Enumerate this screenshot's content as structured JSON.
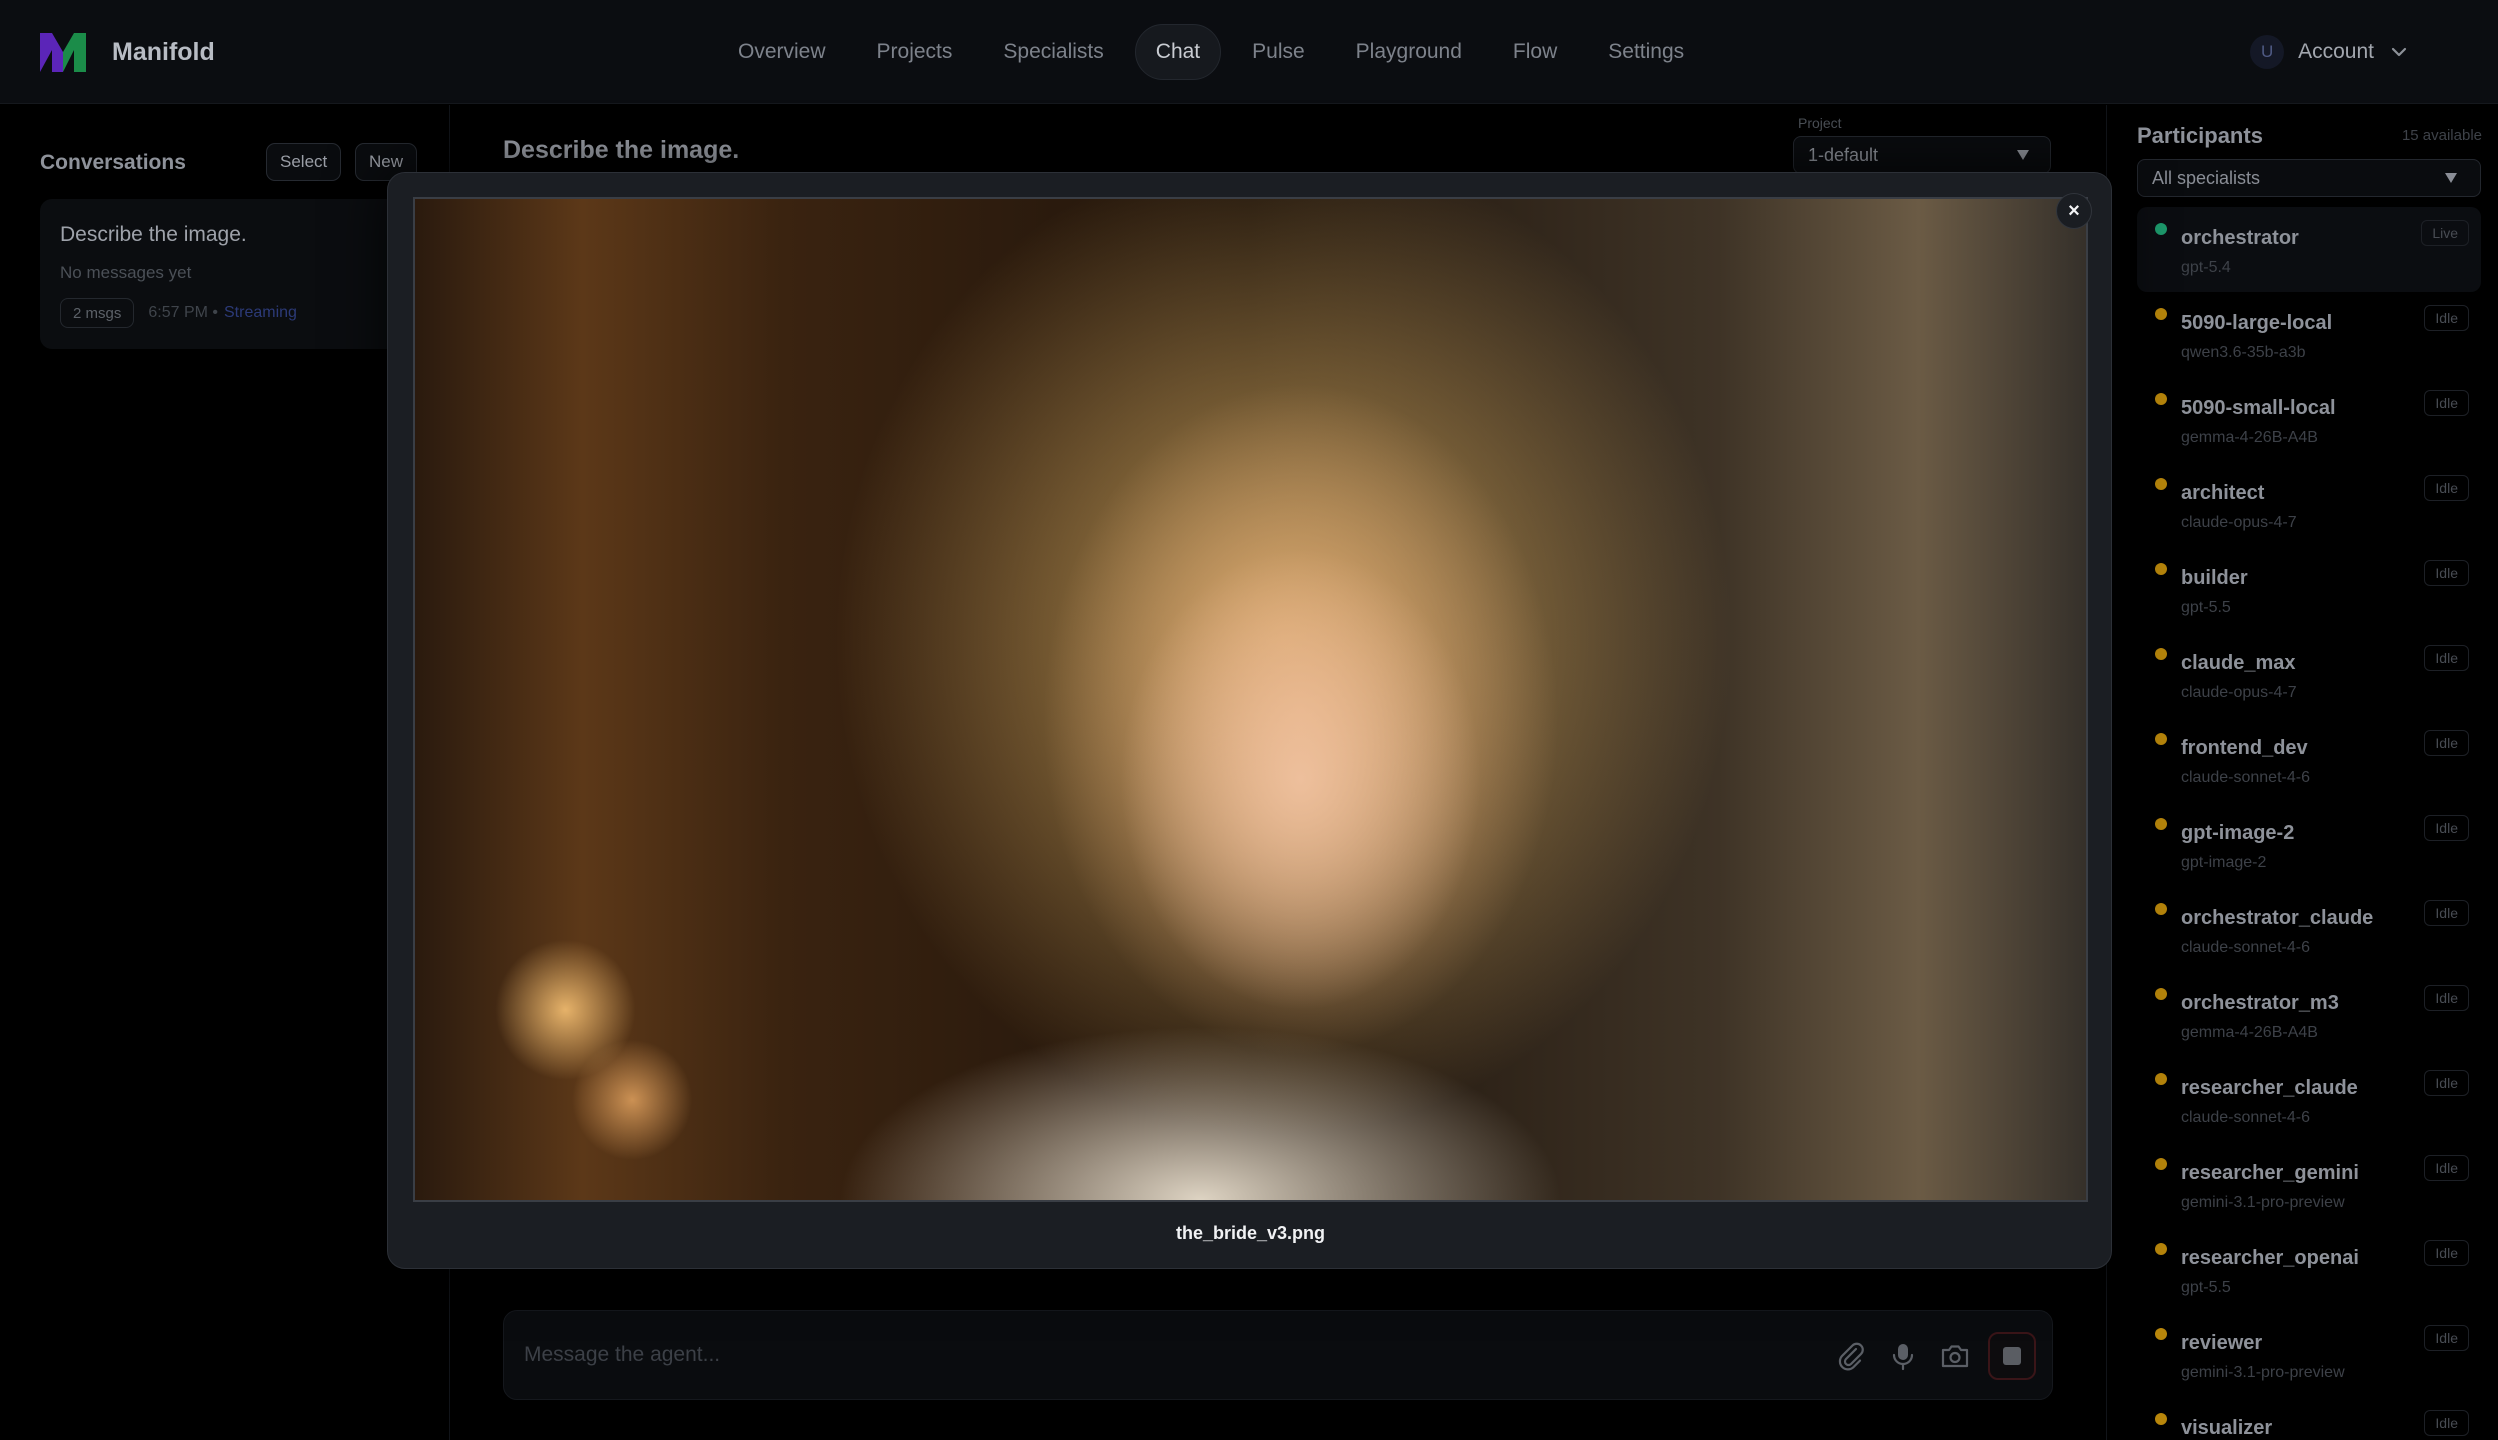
{
  "app": {
    "name": "Manifold",
    "colors": {
      "brand_purple": "#6d2bd9",
      "brand_green": "#1e9f52",
      "live": "#1d9a6c",
      "idle": "#b8860b",
      "stop_border": "#3a1518"
    }
  },
  "nav": {
    "items": [
      {
        "label": "Overview",
        "active": false
      },
      {
        "label": "Projects",
        "active": false
      },
      {
        "label": "Specialists",
        "active": false
      },
      {
        "label": "Chat",
        "active": true
      },
      {
        "label": "Pulse",
        "active": false
      },
      {
        "label": "Playground",
        "active": false
      },
      {
        "label": "Flow",
        "active": false
      },
      {
        "label": "Settings",
        "active": false
      }
    ]
  },
  "account": {
    "avatar_initial": "U",
    "label": "Account"
  },
  "conversations": {
    "title": "Conversations",
    "select_label": "Select",
    "new_label": "New",
    "items": [
      {
        "title": "Describe the image.",
        "subtitle": "No messages yet",
        "count": "2 msgs",
        "time": "6:57 PM •",
        "status": "Streaming"
      }
    ]
  },
  "chat": {
    "title": "Describe the image.",
    "project_label": "Project",
    "project_value": "1-default",
    "composer_placeholder": "Message the agent..."
  },
  "participants": {
    "title": "Participants",
    "count_text": "15 available",
    "filter_value": "All specialists",
    "items": [
      {
        "name": "orchestrator",
        "model": "gpt-5.4",
        "status": "Live"
      },
      {
        "name": "5090-large-local",
        "model": "qwen3.6-35b-a3b",
        "status": "Idle"
      },
      {
        "name": "5090-small-local",
        "model": "gemma-4-26B-A4B",
        "status": "Idle"
      },
      {
        "name": "architect",
        "model": "claude-opus-4-7",
        "status": "Idle"
      },
      {
        "name": "builder",
        "model": "gpt-5.5",
        "status": "Idle"
      },
      {
        "name": "claude_max",
        "model": "claude-opus-4-7",
        "status": "Idle"
      },
      {
        "name": "frontend_dev",
        "model": "claude-sonnet-4-6",
        "status": "Idle"
      },
      {
        "name": "gpt-image-2",
        "model": "gpt-image-2",
        "status": "Idle"
      },
      {
        "name": "orchestrator_claude",
        "model": "claude-sonnet-4-6",
        "status": "Idle"
      },
      {
        "name": "orchestrator_m3",
        "model": "gemma-4-26B-A4B",
        "status": "Idle"
      },
      {
        "name": "researcher_claude",
        "model": "claude-sonnet-4-6",
        "status": "Idle"
      },
      {
        "name": "researcher_gemini",
        "model": "gemini-3.1-pro-preview",
        "status": "Idle"
      },
      {
        "name": "researcher_openai",
        "model": "gpt-5.5",
        "status": "Idle"
      },
      {
        "name": "reviewer",
        "model": "gemini-3.1-pro-preview",
        "status": "Idle"
      },
      {
        "name": "visualizer",
        "model": "",
        "status": "Idle"
      }
    ]
  },
  "modal": {
    "filename": "the_bride_v3.png",
    "close_label": "×"
  }
}
